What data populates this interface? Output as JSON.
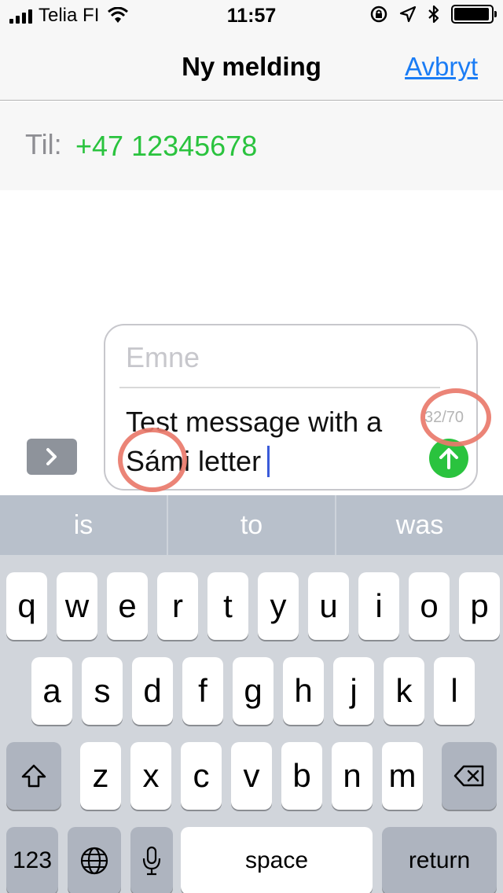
{
  "status_bar": {
    "carrier": "Telia FI",
    "time": "11:57",
    "battery_level": 0.95
  },
  "nav": {
    "title": "Ny melding",
    "cancel_label": "Avbryt"
  },
  "recipient": {
    "label": "Til:",
    "value": "+47 12345678"
  },
  "compose": {
    "subject_placeholder": "Emne",
    "message_text": "Test message with a Sámi letter",
    "char_counter": "32/70"
  },
  "keyboard": {
    "predictions": [
      "is",
      "to",
      "was"
    ],
    "row1": [
      "q",
      "w",
      "e",
      "r",
      "t",
      "y",
      "u",
      "i",
      "o",
      "p"
    ],
    "row2": [
      "a",
      "s",
      "d",
      "f",
      "g",
      "h",
      "j",
      "k",
      "l"
    ],
    "row3": [
      "z",
      "x",
      "c",
      "v",
      "b",
      "n",
      "m"
    ],
    "numbers_label": "123",
    "space_label": "space",
    "return_label": "return"
  },
  "colors": {
    "accent": "#1a7cf5",
    "recipient_green": "#2ac33e",
    "send_button": "#2ac33e",
    "annotation_circle": "#e97a6b"
  },
  "icons": {
    "expand": "chevron-right-icon",
    "send": "arrow-up-icon",
    "shift": "shift-icon",
    "delete": "delete-backspace-icon",
    "globe": "globe-icon",
    "dictation": "microphone-icon"
  }
}
